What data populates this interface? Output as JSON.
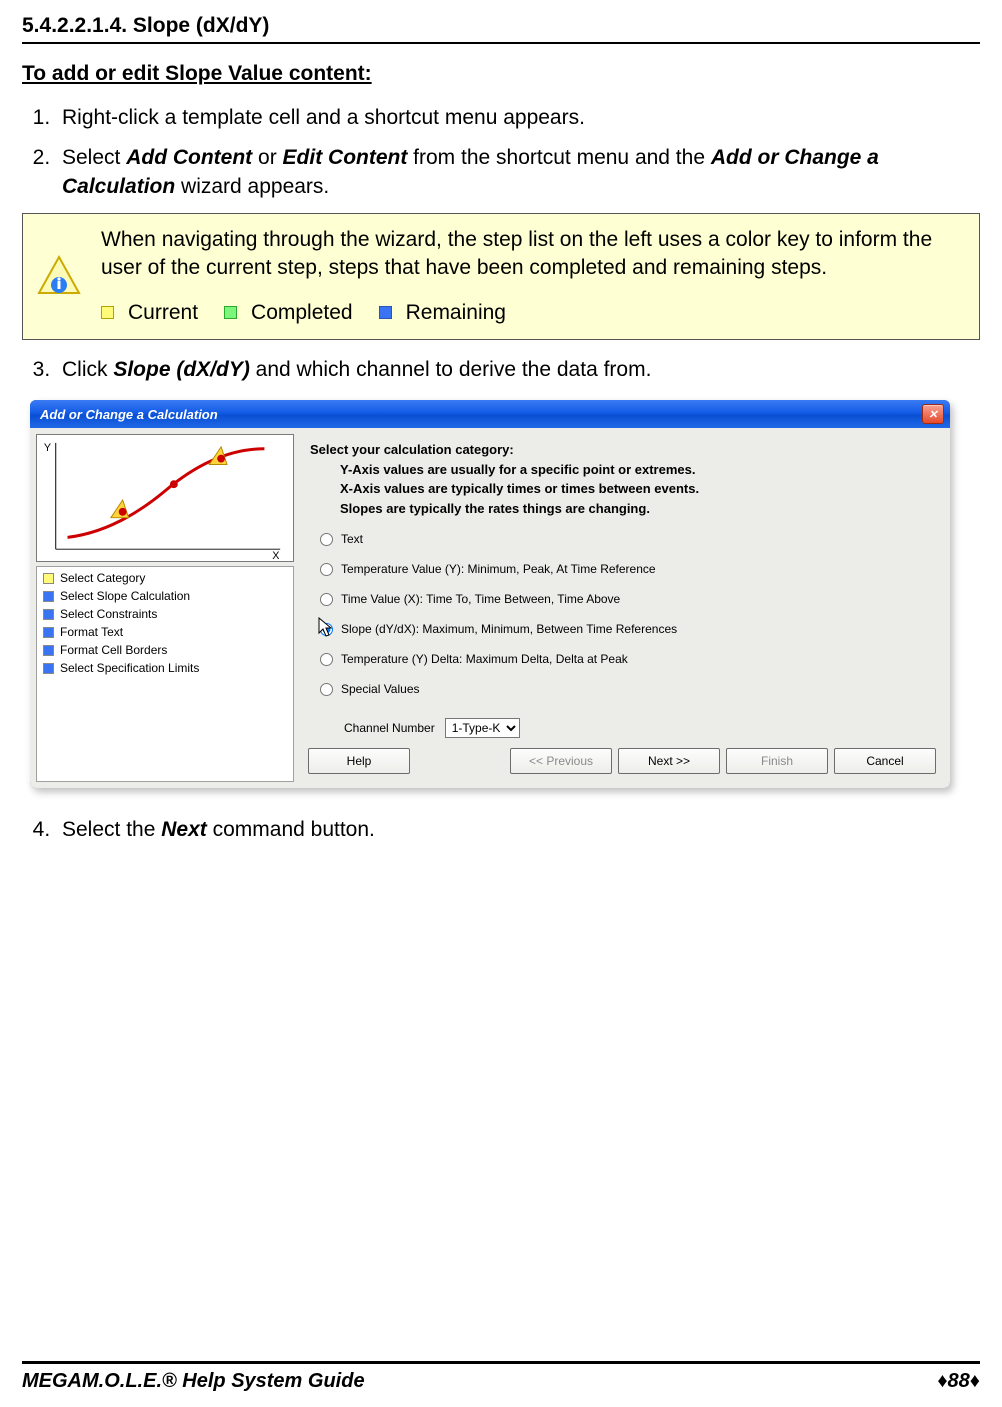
{
  "heading": "5.4.2.2.1.4. Slope (dX/dY)",
  "subheading": "To add or edit Slope Value content:",
  "steps": {
    "s1": "Right-click a template cell and a shortcut menu appears.",
    "s2_pre": "Select ",
    "s2_b1": "Add Content",
    "s2_mid1": " or ",
    "s2_b2": "Edit Content",
    "s2_mid2": " from the shortcut menu and the ",
    "s2_b3": "Add or Change a Calculation",
    "s2_post": " wizard appears.",
    "s3_pre": "Click ",
    "s3_b1": "Slope (dX/dY)",
    "s3_post": " and which channel to derive the data from.",
    "s4_pre": "Select the ",
    "s4_b1": "Next",
    "s4_post": " command button."
  },
  "note": {
    "text": "When navigating through the wizard, the step list on the left uses a color key to inform the user of the current step, steps that have been completed and remaining steps.",
    "legend": {
      "current": "Current",
      "completed": "Completed",
      "remaining": "Remaining"
    }
  },
  "dialog": {
    "title": "Add or Change a Calculation",
    "steps_list": [
      {
        "label": "Select Category",
        "status": "current"
      },
      {
        "label": "Select Slope Calculation",
        "status": "remaining"
      },
      {
        "label": "Select Constraints",
        "status": "remaining"
      },
      {
        "label": "Format Text",
        "status": "remaining"
      },
      {
        "label": "Format Cell Borders",
        "status": "remaining"
      },
      {
        "label": "Select Specification Limits",
        "status": "remaining"
      }
    ],
    "instr_title": "Select your calculation category:",
    "instr_l1": "Y-Axis values are usually for a specific point or extremes.",
    "instr_l2": "X-Axis values are typically times or times between events.",
    "instr_l3": "Slopes are typically the rates things are changing.",
    "radios": {
      "r1": "Text",
      "r2": "Temperature Value (Y):  Minimum, Peak, At Time Reference",
      "r3": "Time Value (X):  Time To, Time Between, Time Above",
      "r4": "Slope (dY/dX):  Maximum, Minimum, Between Time References",
      "r5": "Temperature (Y) Delta:  Maximum Delta, Delta at Peak",
      "r6": "Special  Values"
    },
    "channel_label": "Channel Number",
    "channel_value": "1-Type-K",
    "buttons": {
      "help": "Help",
      "prev": "<< Previous",
      "next": "Next >>",
      "finish": "Finish",
      "cancel": "Cancel"
    }
  },
  "footer": {
    "left_prefix": "MEGA",
    "left_rest": "M.O.L.E.® Help System Guide",
    "right": "♦88♦"
  }
}
